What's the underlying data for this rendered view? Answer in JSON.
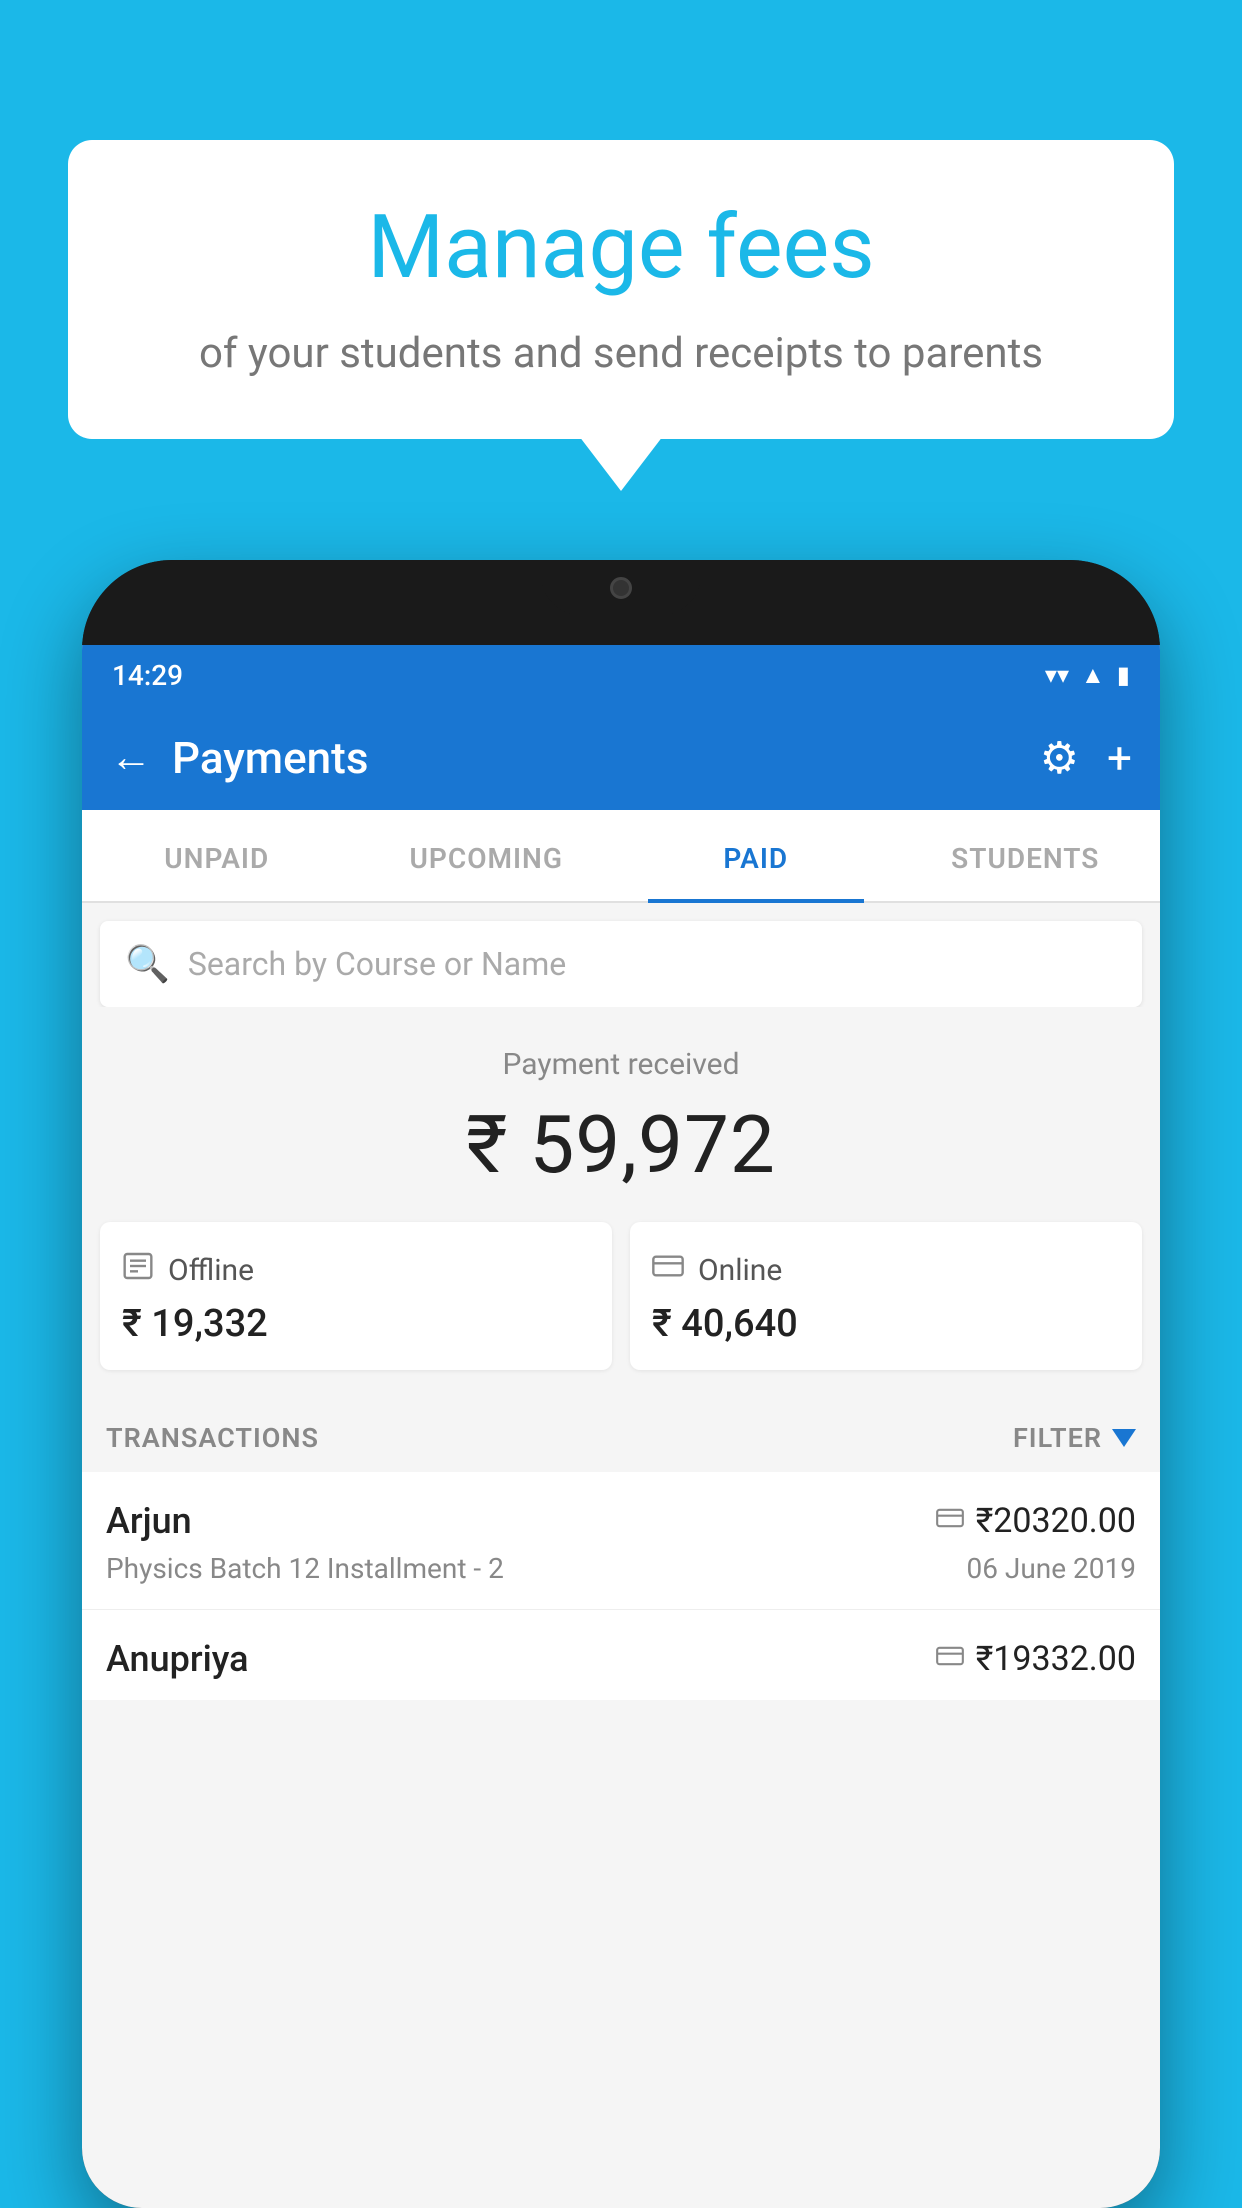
{
  "background_color": "#1BB8E8",
  "speech_bubble": {
    "title": "Manage fees",
    "subtitle": "of your students and send receipts to parents"
  },
  "status_bar": {
    "time": "14:29",
    "wifi_icon": "▼",
    "signal_icon": "▲",
    "battery_icon": "▮"
  },
  "app_bar": {
    "title": "Payments",
    "back_label": "←",
    "gear_label": "⚙",
    "plus_label": "+"
  },
  "tabs": [
    {
      "label": "UNPAID",
      "active": false
    },
    {
      "label": "UPCOMING",
      "active": false
    },
    {
      "label": "PAID",
      "active": true
    },
    {
      "label": "STUDENTS",
      "active": false
    }
  ],
  "search": {
    "placeholder": "Search by Course or Name"
  },
  "payment_received": {
    "label": "Payment received",
    "amount": "₹ 59,972"
  },
  "payment_cards": {
    "offline": {
      "icon": "🖨",
      "label": "Offline",
      "amount": "₹ 19,332"
    },
    "online": {
      "icon": "💳",
      "label": "Online",
      "amount": "₹ 40,640"
    }
  },
  "transactions": {
    "header_label": "TRANSACTIONS",
    "filter_label": "FILTER",
    "rows": [
      {
        "name": "Arjun",
        "course": "Physics Batch 12 Installment - 2",
        "amount": "₹20320.00",
        "date": "06 June 2019",
        "payment_type": "online"
      },
      {
        "name": "Anupriya",
        "amount": "₹19332.00",
        "payment_type": "offline"
      }
    ]
  }
}
